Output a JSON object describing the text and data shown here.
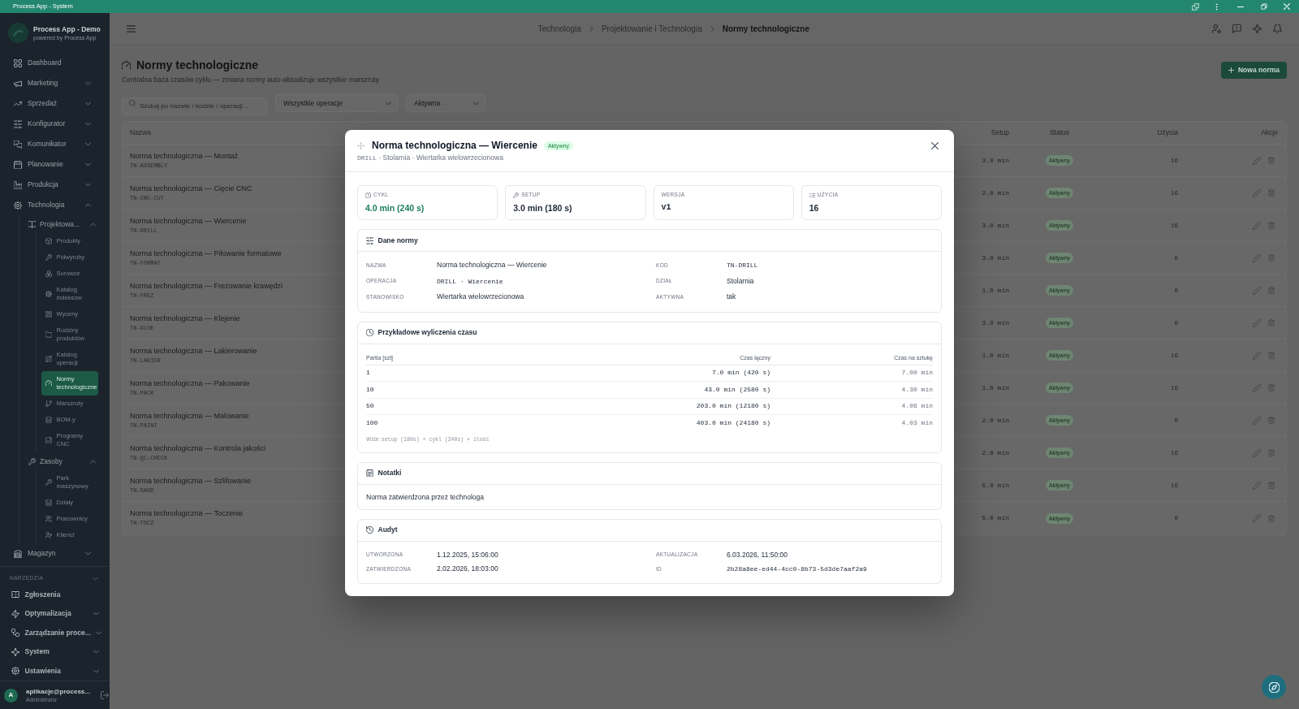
{
  "title_bar": {
    "title": "Process App - System"
  },
  "sidebar": {
    "brand": {
      "name": "Process App - Demo",
      "tagline": "powered by Process App"
    },
    "nav": [
      {
        "label": "Dashboard",
        "selected": false
      },
      {
        "label": "Marketing",
        "selected": false,
        "expanded": false
      },
      {
        "label": "Sprzedaż",
        "selected": false,
        "expanded": false
      },
      {
        "label": "Konfigurator",
        "selected": false,
        "expanded": false
      },
      {
        "label": "Komunikator",
        "selected": false,
        "expanded": false
      },
      {
        "label": "Planowanie",
        "selected": false,
        "expanded": false
      },
      {
        "label": "Produkcja",
        "selected": false,
        "expanded": false
      },
      {
        "label": "Technologia",
        "selected": false,
        "expanded": true,
        "children": [
          {
            "label": "Projektowa...",
            "selected": false,
            "expanded": true,
            "children": [
              {
                "label": "Produkty",
                "selected": false
              },
              {
                "label": "Półwyroby",
                "selected": false
              },
              {
                "label": "Surowce",
                "selected": false
              },
              {
                "label": "Katalog indeksów",
                "selected": false
              },
              {
                "label": "Wyceny",
                "selected": false
              },
              {
                "label": "Rodziny produktów",
                "selected": false
              },
              {
                "label": "Katalog operacji",
                "selected": false
              },
              {
                "label": "Normy technologiczne",
                "selected": true
              },
              {
                "label": "Marszruty",
                "selected": false
              },
              {
                "label": "BOM-y",
                "selected": false
              },
              {
                "label": "Programy CNC",
                "selected": false
              }
            ]
          },
          {
            "label": "Zasoby",
            "selected": false,
            "expanded": true,
            "children": [
              {
                "label": "Park maszynowy",
                "selected": false
              },
              {
                "label": "Działy",
                "selected": false
              },
              {
                "label": "Pracownicy",
                "selected": false
              },
              {
                "label": "Klienci",
                "selected": false
              }
            ]
          }
        ]
      },
      {
        "label": "Magazyn",
        "selected": false,
        "expanded": false
      }
    ],
    "tools": {
      "heading": "NARZĘDZIA",
      "expanded": true,
      "items": [
        {
          "label": "Zgłoszenia",
          "selected": false
        },
        {
          "label": "Optymalizacja",
          "selected": false,
          "expanded": false
        },
        {
          "label": "Zarządzanie proce...",
          "selected": false,
          "expanded": false
        },
        {
          "label": "System",
          "selected": false,
          "expanded": false
        },
        {
          "label": "Ustawienia",
          "selected": false,
          "expanded": false
        }
      ]
    },
    "user": {
      "initial": "A",
      "email": "aplikacje@process...",
      "role": "Administrator"
    }
  },
  "header": {
    "breadcrumbs": [
      {
        "label": "Technologia",
        "current": false
      },
      {
        "label": "Projektowanie i Technologia",
        "current": false
      },
      {
        "label": "Normy technologiczne",
        "current": true
      }
    ]
  },
  "page": {
    "title": "Normy technologiczne",
    "subtitle": "Centralna baza czasów cyklu — zmiana normy auto-aktualizuje wszystkie marszruty",
    "primary_button": "Nowa norma",
    "search": {
      "placeholder": "Szukaj po nazwie / kodzie / operacji..."
    },
    "selects": [
      {
        "value": "Wszystkie operacje"
      },
      {
        "value": "Aktywna"
      }
    ]
  },
  "table": {
    "columns": [
      "Nazwa",
      "Setup",
      "Status",
      "Użycia",
      "Akcje"
    ],
    "rows": [
      {
        "name": "Norma technologiczna — Montaż",
        "code": "TN-ASSEMBLY",
        "setup": "3.0 min",
        "status": "Aktywny",
        "uses": "16"
      },
      {
        "name": "Norma technologiczna — Cięcie CNC",
        "code": "TN-CNC-CUT",
        "setup": "2.0 min",
        "status": "Aktywny",
        "uses": "16"
      },
      {
        "name": "Norma technologiczna — Wiercenie",
        "code": "TN-DRILL",
        "setup": "3.0 min",
        "status": "Aktywny",
        "uses": "16"
      },
      {
        "name": "Norma technologiczna — Piłowanie formatowe",
        "code": "TN-FORMAT",
        "setup": "3.0 min",
        "status": "Aktywny",
        "uses": "0"
      },
      {
        "name": "Norma technologiczna — Frezowanie krawędzi",
        "code": "TN-FREZ",
        "setup": "1.0 min",
        "status": "Aktywny",
        "uses": "0"
      },
      {
        "name": "Norma technologiczna — Klejenie",
        "code": "TN-GLUE",
        "setup": "3.0 min",
        "status": "Aktywny",
        "uses": "0"
      },
      {
        "name": "Norma technologiczna — Lakierowanie",
        "code": "TN-LAKIER",
        "setup": "1.0 min",
        "status": "Aktywny",
        "uses": "16"
      },
      {
        "name": "Norma technologiczna — Pakowanie",
        "code": "TN-PACK",
        "setup": "1.0 min",
        "status": "Aktywny",
        "uses": "16"
      },
      {
        "name": "Norma technologiczna — Malowanie",
        "code": "TN-PAINT",
        "setup": "2.0 min",
        "status": "Aktywny",
        "uses": "0"
      },
      {
        "name": "Norma technologiczna — Kontrola jakości",
        "code": "TN-QC-CHECK",
        "setup": "2.0 min",
        "status": "Aktywny",
        "uses": "16"
      },
      {
        "name": "Norma technologiczna — Szlifowanie",
        "code": "TN-SAND",
        "setup": "5.0 min",
        "status": "Aktywny",
        "uses": "16"
      },
      {
        "name": "Norma technologiczna — Toczenie",
        "code": "TN-TOCZ",
        "setup": "5.0 min",
        "status": "Aktywny",
        "uses": "0"
      }
    ]
  },
  "modal": {
    "title": "Norma technologiczna — Wiercenie",
    "status_badge": "Aktywny",
    "subtitle": {
      "code": "DRILL",
      "text": "· Stolarnia · Wiertarka wielowrzecionowa"
    },
    "stats": [
      {
        "label": "CYKL",
        "value": "4.0 min (240 s)",
        "kind": "text",
        "color": "#1d7f5a"
      },
      {
        "label": "SETUP",
        "value": "3.0 min (180 s)",
        "kind": "text",
        "color": "#1f2937"
      },
      {
        "label": "WERSJA",
        "value": "v1",
        "kind": "code",
        "color": "#1f2937"
      },
      {
        "label": "UŻYCIA",
        "value": "16",
        "kind": "text",
        "color": "#1f2937"
      }
    ],
    "details": {
      "title": "Dane normy",
      "fields": [
        {
          "label": "NAZWA",
          "value": "Norma technologiczna — Wiercenie",
          "kind": "text"
        },
        {
          "label": "KOD",
          "value": "TN-DRILL",
          "kind": "code"
        },
        {
          "label": "OPERACJA",
          "value": "DRILL · Wiercenie",
          "kind": "code"
        },
        {
          "label": "DZIAŁ",
          "value": "Stolarnia",
          "kind": "text"
        },
        {
          "label": "STANOWISKO",
          "value": "Wiertarka wielowrzecionowa",
          "kind": "text"
        },
        {
          "label": "AKTYWNA",
          "value": "tak",
          "kind": "text"
        }
      ]
    },
    "calculations": {
      "title": "Przykładowe wyliczenia czasu",
      "columns": [
        "Partia [szt]",
        "Czas łączny",
        "Czas na sztukę"
      ],
      "rows": [
        {
          "batch": "1",
          "total": "7.0 min (420 s)",
          "per_piece": "7.00 min"
        },
        {
          "batch": "10",
          "total": "43.0 min (2580 s)",
          "per_piece": "4.30 min"
        },
        {
          "batch": "50",
          "total": "203.0 min (12180 s)",
          "per_piece": "4.06 min"
        },
        {
          "batch": "100",
          "total": "403.0 min (24180 s)",
          "per_piece": "4.03 min"
        }
      ],
      "formula": {
        "label": "Wzór:",
        "expression": "setup (180s) + cykl (240s) × ilość"
      }
    },
    "notes": {
      "title": "Notatki",
      "text": "Norma zatwierdzona przez technologa"
    },
    "audit": {
      "title": "Audyt",
      "fields": [
        {
          "label": "UTWORZONA",
          "value": "1.12.2025, 15:06:00",
          "kind": "text"
        },
        {
          "label": "AKTUALIZACJA",
          "value": "6.03.2026, 11:50:00",
          "kind": "text"
        },
        {
          "label": "ZATWIERDZONA",
          "value": "2.02.2026, 18:03:00",
          "kind": "text"
        },
        {
          "label": "ID",
          "value": "2b28a8ee-ed44-4cc0-8b73-5d3de7aaf2a9",
          "kind": "code"
        }
      ]
    }
  }
}
